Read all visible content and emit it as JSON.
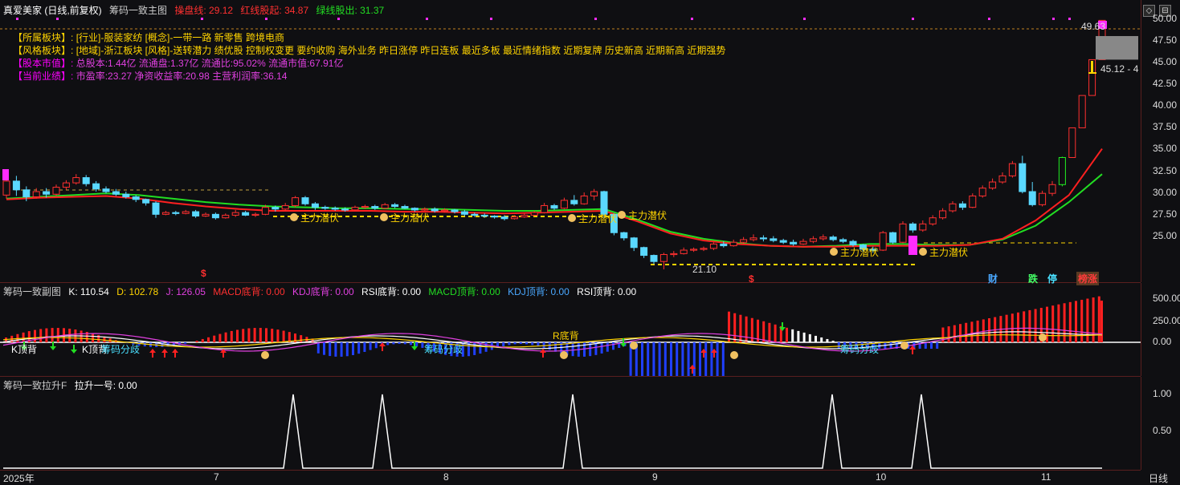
{
  "main": {
    "stock_title": "真爱美家 (日线,前复权)",
    "indicator_name": "筹码一致主图",
    "readouts": [
      {
        "text": "操盘线: 29.12",
        "color": "#ff3030"
      },
      {
        "text": "红线股起: 34.87",
        "color": "#ff3030"
      },
      {
        "text": "绿线股出: 31.37",
        "color": "#22dd22"
      }
    ],
    "info_rows": [
      {
        "label": "【所属板块】:",
        "value": "[行业]-服装家纺 [概念]-一带一路 新零售 跨境电商",
        "value_color": "#ffd400"
      },
      {
        "label": "【风格板块】:",
        "value": "[地域]-浙江板块 [风格]-送转潜力 绩优股 控制权变更 要约收购 海外业务 昨日涨停 昨日连板 最近多板 最近情绪指数 近期复牌 历史新高 近期新高 近期强势",
        "value_color": "#ffd400"
      },
      {
        "label": "【股本市值】:",
        "value": "总股本:1.44亿 流通盘:1.37亿 流通比:95.02% 流通市值:67.91亿",
        "value_color": "#e040e0"
      },
      {
        "label": "【当前业绩】:",
        "value": "市盈率:23.27 净资收益率:20.98 主营利润率:36.14",
        "value_color": "#e040e0"
      }
    ],
    "y_ticks": [
      "50.00",
      "47.50",
      "45.00",
      "42.50",
      "40.00",
      "37.50",
      "35.00",
      "32.50",
      "30.00",
      "27.50",
      "25.00"
    ],
    "high_label": "49.63",
    "low_label": "21.10",
    "price_label": "45.12 - 4",
    "zhuli_label": "主力潜伏",
    "dollar_glyph": "$",
    "bottom_marks": [
      {
        "text": "财",
        "color": "#4aa8ff"
      },
      {
        "text": "跌",
        "color": "#44ff66"
      },
      {
        "text": "停",
        "color": "#4ae0ff"
      },
      {
        "text": "榜涨",
        "color": "#ff3a3a"
      }
    ]
  },
  "sub": {
    "indicator_name": "筹码一致副图",
    "readouts": [
      {
        "text": "K: 110.54",
        "color": "#ffffff"
      },
      {
        "text": "D: 102.78",
        "color": "#ffd400"
      },
      {
        "text": "J: 126.05",
        "color": "#e040e0"
      },
      {
        "text": "MACD底背: 0.00",
        "color": "#ff3030"
      },
      {
        "text": "KDJ底背: 0.00",
        "color": "#e040e0"
      },
      {
        "text": "RSI底背: 0.00",
        "color": "#ffffff"
      },
      {
        "text": "MACD顶背: 0.00",
        "color": "#22dd22"
      },
      {
        "text": "KDJ顶背: 0.00",
        "color": "#4aa8ff"
      },
      {
        "text": "RSI顶背: 0.00",
        "color": "#ffffff"
      }
    ],
    "y_ticks": [
      "500.00",
      "250.00",
      "0.00"
    ],
    "labels": {
      "kbei": "K顶背",
      "rdibei": "R底背",
      "chouma": "筹码分歧"
    }
  },
  "third": {
    "indicator_name": "筹码一致拉升F",
    "readout": "拉升一号: 0.00",
    "y_ticks": [
      "1.00",
      "0.50"
    ]
  },
  "xaxis": {
    "labels": [
      "2025年",
      "7",
      "8",
      "9",
      "10",
      "11"
    ],
    "period": "日线"
  },
  "chart_data": {
    "type": "candlestick",
    "candles": [
      [
        29.6,
        31.2,
        29.2,
        32.5
      ],
      [
        31.2,
        30.2,
        29.5,
        31.8
      ],
      [
        30.2,
        29.4,
        28.9,
        30.6
      ],
      [
        29.4,
        30.0,
        29.2,
        30.4
      ],
      [
        30.0,
        29.7,
        29.3,
        30.4
      ],
      [
        29.7,
        30.5,
        29.5,
        30.8
      ],
      [
        30.5,
        31.0,
        30.2,
        31.3
      ],
      [
        31.0,
        31.6,
        30.8,
        32.0
      ],
      [
        31.6,
        30.9,
        30.6,
        31.9
      ],
      [
        30.9,
        30.3,
        30.0,
        31.2
      ],
      [
        30.3,
        30.0,
        29.8,
        30.6
      ],
      [
        30.0,
        29.7,
        29.5,
        30.3
      ],
      [
        29.7,
        29.4,
        29.2,
        30.0
      ],
      [
        29.4,
        29.1,
        28.8,
        29.6
      ],
      [
        29.1,
        28.7,
        28.4,
        29.2
      ],
      [
        28.7,
        27.4,
        27.0,
        28.9
      ],
      [
        27.4,
        27.6,
        27.3,
        27.8
      ],
      [
        27.6,
        27.5,
        27.3,
        27.8
      ],
      [
        27.5,
        27.7,
        27.4,
        27.9
      ],
      [
        27.7,
        27.2,
        27.0,
        27.9
      ],
      [
        27.2,
        27.4,
        27.1,
        27.6
      ],
      [
        27.4,
        27.0,
        26.8,
        27.6
      ],
      [
        27.0,
        27.3,
        26.9,
        27.5
      ],
      [
        27.3,
        27.6,
        27.1,
        27.9
      ],
      [
        27.6,
        27.3,
        27.2,
        27.8
      ],
      [
        27.3,
        27.4,
        27.1,
        27.6
      ],
      [
        27.4,
        28.2,
        27.3,
        28.5
      ],
      [
        28.2,
        28.0,
        27.7,
        28.4
      ],
      [
        28.0,
        28.4,
        27.8,
        28.7
      ],
      [
        28.4,
        29.3,
        28.2,
        29.5
      ],
      [
        29.3,
        28.6,
        28.4,
        29.5
      ],
      [
        28.6,
        28.2,
        27.9,
        28.8
      ],
      [
        28.2,
        28.1,
        27.9,
        28.4
      ],
      [
        28.1,
        28.0,
        27.8,
        28.3
      ],
      [
        28.0,
        27.9,
        27.7,
        28.2
      ],
      [
        27.9,
        28.2,
        27.8,
        28.4
      ],
      [
        28.2,
        28.3,
        28.0,
        28.5
      ],
      [
        28.3,
        28.1,
        27.9,
        28.5
      ],
      [
        28.1,
        28.5,
        28.0,
        28.7
      ],
      [
        28.5,
        28.3,
        28.1,
        28.7
      ],
      [
        28.3,
        28.1,
        28.0,
        28.5
      ],
      [
        28.1,
        27.9,
        27.7,
        28.2
      ],
      [
        27.9,
        28.0,
        27.8,
        28.2
      ],
      [
        28.0,
        27.8,
        27.6,
        28.2
      ],
      [
        27.8,
        27.9,
        27.6,
        28.1
      ],
      [
        27.9,
        27.7,
        27.5,
        28.0
      ],
      [
        27.7,
        27.4,
        27.2,
        27.9
      ],
      [
        27.4,
        27.3,
        27.1,
        27.6
      ],
      [
        27.3,
        27.2,
        27.0,
        27.5
      ],
      [
        27.2,
        27.1,
        26.9,
        27.3
      ],
      [
        27.1,
        26.9,
        26.7,
        27.3
      ],
      [
        26.9,
        27.1,
        26.8,
        27.3
      ],
      [
        27.1,
        27.3,
        27.0,
        27.5
      ],
      [
        27.3,
        27.6,
        27.2,
        27.8
      ],
      [
        27.6,
        28.4,
        27.5,
        28.7
      ],
      [
        28.4,
        28.1,
        27.9,
        28.6
      ],
      [
        28.1,
        29.0,
        28.0,
        29.3
      ],
      [
        29.0,
        28.6,
        28.4,
        29.6
      ],
      [
        28.6,
        29.5,
        28.5,
        29.9
      ],
      [
        29.5,
        30.0,
        29.0,
        30.3
      ],
      [
        30.0,
        27.4,
        27.0,
        30.1
      ],
      [
        27.4,
        25.3,
        25.0,
        27.5
      ],
      [
        25.3,
        24.7,
        24.4,
        25.4
      ],
      [
        24.7,
        23.6,
        23.2,
        24.8
      ],
      [
        23.6,
        22.7,
        22.4,
        23.7
      ],
      [
        22.7,
        22.0,
        21.7,
        22.8
      ],
      [
        22.0,
        22.8,
        21.1,
        23.0
      ],
      [
        22.8,
        22.9,
        22.5,
        23.2
      ],
      [
        22.9,
        23.3,
        22.8,
        23.6
      ],
      [
        23.3,
        23.4,
        23.1,
        23.6
      ],
      [
        23.4,
        23.5,
        23.2,
        23.7
      ],
      [
        23.5,
        24.0,
        23.3,
        24.2
      ],
      [
        24.0,
        23.8,
        23.6,
        24.3
      ],
      [
        23.8,
        24.2,
        23.7,
        24.5
      ],
      [
        24.2,
        24.5,
        24.0,
        24.8
      ],
      [
        24.5,
        24.7,
        24.3,
        25.1
      ],
      [
        24.7,
        24.6,
        24.3,
        25.0
      ],
      [
        24.6,
        24.4,
        24.2,
        24.9
      ],
      [
        24.4,
        24.2,
        24.0,
        24.6
      ],
      [
        24.2,
        24.0,
        23.8,
        24.5
      ],
      [
        24.0,
        24.3,
        23.9,
        24.6
      ],
      [
        24.3,
        24.6,
        24.1,
        24.9
      ],
      [
        24.6,
        24.8,
        24.4,
        25.1
      ],
      [
        24.8,
        24.5,
        24.3,
        25.0
      ],
      [
        24.5,
        24.3,
        24.1,
        24.7
      ],
      [
        24.3,
        23.9,
        23.7,
        24.5
      ],
      [
        23.9,
        23.4,
        23.1,
        24.0
      ],
      [
        23.4,
        23.3,
        23.0,
        23.7
      ],
      [
        23.3,
        25.3,
        23.2,
        25.5
      ],
      [
        25.3,
        24.2,
        24.0,
        25.4
      ],
      [
        24.2,
        26.3,
        24.1,
        26.6
      ],
      [
        26.3,
        25.6,
        25.3,
        26.5
      ],
      [
        25.6,
        26.3,
        25.4,
        26.7
      ],
      [
        26.3,
        27.0,
        26.1,
        27.3
      ],
      [
        27.0,
        27.8,
        26.8,
        28.1
      ],
      [
        27.8,
        28.6,
        27.6,
        28.9
      ],
      [
        28.6,
        28.2,
        27.9,
        28.9
      ],
      [
        28.2,
        29.5,
        28.1,
        29.8
      ],
      [
        29.5,
        30.4,
        29.3,
        30.7
      ],
      [
        30.4,
        31.1,
        30.2,
        31.5
      ],
      [
        31.1,
        31.8,
        30.9,
        32.2
      ],
      [
        31.8,
        33.2,
        31.6,
        33.5
      ],
      [
        33.2,
        30.0,
        29.8,
        34.1
      ],
      [
        30.0,
        28.5,
        28.3,
        31.1
      ],
      [
        28.5,
        29.8,
        28.3,
        30.1
      ],
      [
        29.8,
        30.8,
        29.5,
        31.2
      ],
      [
        30.8,
        33.9,
        30.6,
        34.0
      ],
      [
        33.9,
        37.3,
        33.9,
        37.3
      ],
      [
        37.3,
        41.0,
        37.3,
        41.0
      ],
      [
        41.0,
        45.1,
        41.0,
        45.1
      ],
      [
        45.1,
        49.6,
        45.1,
        49.6
      ]
    ],
    "zt_gap_candle": [
      47.6,
      45.1
    ],
    "ma_green": [
      29.2,
      29.4,
      29.6,
      29.8,
      29.6,
      29.2,
      28.8,
      28.5,
      28.3,
      28.2,
      28.1,
      28.1,
      28.0,
      28.0,
      27.9,
      27.8,
      27.8,
      27.9,
      28.0,
      26.8,
      25.4,
      24.6,
      24.1,
      23.8,
      23.7,
      23.8,
      24.0,
      24.0,
      23.9,
      23.9,
      24.5,
      26.1,
      28.8,
      32.0
    ],
    "ma_red": [
      29.1,
      29.3,
      29.4,
      29.5,
      29.2,
      28.7,
      28.3,
      28.0,
      27.8,
      27.8,
      27.8,
      27.8,
      27.7,
      27.7,
      27.6,
      27.5,
      27.6,
      27.7,
      27.8,
      26.6,
      25.2,
      24.4,
      24.0,
      23.8,
      23.7,
      23.7,
      23.8,
      23.8,
      23.8,
      23.9,
      24.6,
      26.7,
      29.6,
      34.9
    ]
  }
}
